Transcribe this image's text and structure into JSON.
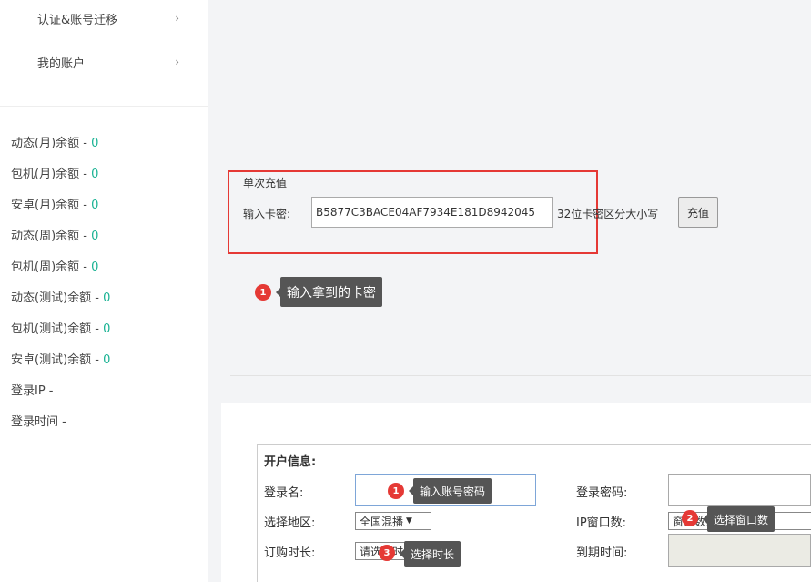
{
  "sidebar": {
    "nav": [
      {
        "label": "认证&账号迁移",
        "chevron": "›"
      },
      {
        "label": "我的账户",
        "chevron": "›"
      }
    ],
    "balances": [
      {
        "label": "动态(月)余额 - ",
        "value": "0"
      },
      {
        "label": "包机(月)余额 - ",
        "value": "0"
      },
      {
        "label": "安卓(月)余额 - ",
        "value": "0"
      },
      {
        "label": "动态(周)余额 - ",
        "value": "0"
      },
      {
        "label": "包机(周)余额 - ",
        "value": "0"
      },
      {
        "label": "动态(测试)余额 - ",
        "value": "0"
      },
      {
        "label": "包机(测试)余额 - ",
        "value": "0"
      },
      {
        "label": "安卓(测试)余额 - ",
        "value": "0"
      }
    ],
    "login_ip": "登录IP -",
    "login_time": "登录时间 -"
  },
  "recharge": {
    "title": "单次充值",
    "card_label": "输入卡密:",
    "card_value": "B5877C3BACE04AF7934E181D8942045",
    "hint": "32位卡密区分大小写",
    "button": "充值",
    "tip_badge": "1",
    "tip_text": "输入拿到的卡密"
  },
  "account_form": {
    "section_title": "开户信息:",
    "username_label": "登录名:",
    "password_label": "登录密码:",
    "region_label": "选择地区:",
    "region_value": "全国混播",
    "ip_window_label": "IP窗口数:",
    "ip_window_value": "窗口数量(购买)",
    "duration_label": "订购时长:",
    "duration_value": "请选择时长",
    "expire_label": "到期时间:",
    "tips": [
      {
        "badge": "1",
        "text": "输入账号密码"
      },
      {
        "badge": "2",
        "text": "选择窗口数"
      },
      {
        "badge": "3",
        "text": "选择时长"
      }
    ]
  },
  "colors": {
    "accent_value": "#1bb394",
    "highlight_border": "#e53935",
    "badge": "#e53935",
    "tooltip_bg": "#555555"
  }
}
